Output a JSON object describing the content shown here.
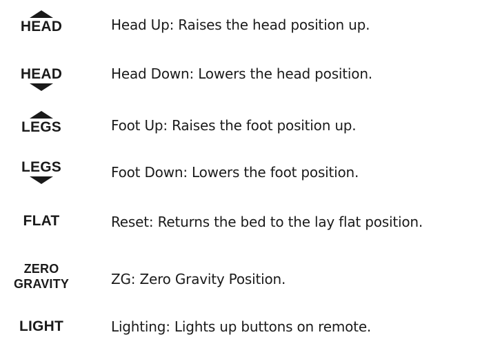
{
  "controls": [
    {
      "key": "head_up",
      "button": "HEAD",
      "arrow": "up",
      "description": "Head Up: Raises the head position up.",
      "icon": "triangle-up-icon"
    },
    {
      "key": "head_down",
      "button": "HEAD",
      "arrow": "down",
      "description": "Head Down: Lowers the head position.",
      "icon": "triangle-down-icon"
    },
    {
      "key": "foot_up",
      "button": "LEGS",
      "arrow": "up",
      "description": "Foot Up: Raises the foot position up.",
      "icon": "triangle-up-icon"
    },
    {
      "key": "foot_down",
      "button": "LEGS",
      "arrow": "down",
      "description": "Foot Down: Lowers the foot position.",
      "icon": "triangle-down-icon"
    },
    {
      "key": "flat",
      "button": "FLAT",
      "description": "Reset: Returns the bed to the lay flat position."
    },
    {
      "key": "zero_gravity",
      "button_line1": "ZERO",
      "button_line2": "GRAVITY",
      "description": "ZG: Zero Gravity Position."
    },
    {
      "key": "light",
      "button": "LIGHT",
      "description": "Lighting: Lights up buttons on remote."
    }
  ],
  "colors": {
    "text": "#1a1a1a",
    "background": "#ffffff"
  }
}
